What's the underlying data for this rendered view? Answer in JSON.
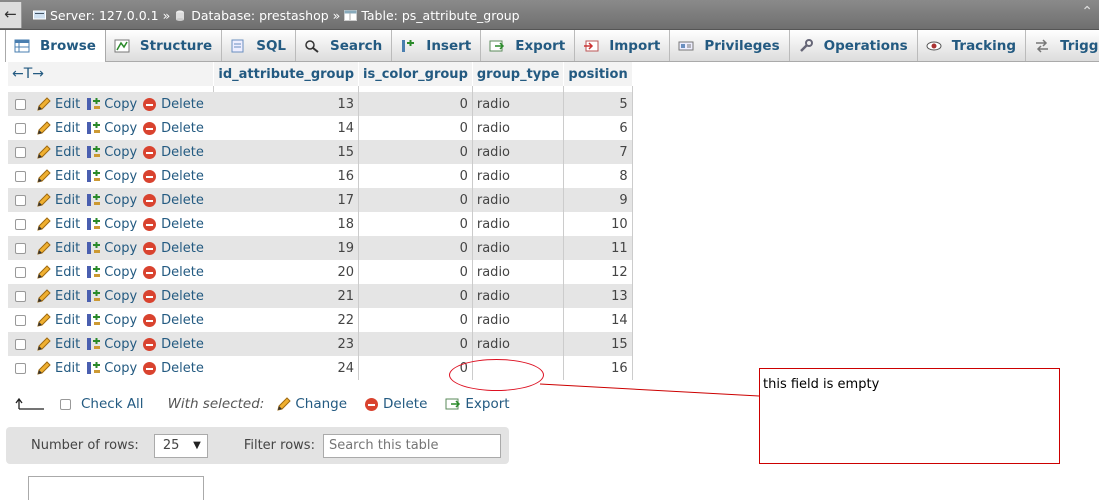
{
  "breadcrumb": {
    "server": "Server: 127.0.0.1",
    "database": "Database: prestashop",
    "table": "Table: ps_attribute_group",
    "separator": "»"
  },
  "tabs": [
    {
      "label": "Browse",
      "icon": "browse-icon"
    },
    {
      "label": "Structure",
      "icon": "structure-icon"
    },
    {
      "label": "SQL",
      "icon": "sql-icon"
    },
    {
      "label": "Search",
      "icon": "search-icon"
    },
    {
      "label": "Insert",
      "icon": "insert-icon"
    },
    {
      "label": "Export",
      "icon": "export-icon"
    },
    {
      "label": "Import",
      "icon": "import-icon"
    },
    {
      "label": "Privileges",
      "icon": "privileges-icon"
    },
    {
      "label": "Operations",
      "icon": "wrench-icon"
    },
    {
      "label": "Tracking",
      "icon": "eye-icon"
    },
    {
      "label": "Triggers",
      "icon": "triggers-icon"
    }
  ],
  "table": {
    "arrows": "←T→",
    "columns": [
      "id_attribute_group",
      "is_color_group",
      "group_type",
      "position"
    ],
    "row_actions": {
      "edit": "Edit",
      "copy": "Copy",
      "delete": "Delete"
    },
    "rows": [
      {
        "id": "13",
        "is_color": "0",
        "type": "radio",
        "pos": "5"
      },
      {
        "id": "14",
        "is_color": "0",
        "type": "radio",
        "pos": "6"
      },
      {
        "id": "15",
        "is_color": "0",
        "type": "radio",
        "pos": "7"
      },
      {
        "id": "16",
        "is_color": "0",
        "type": "radio",
        "pos": "8"
      },
      {
        "id": "17",
        "is_color": "0",
        "type": "radio",
        "pos": "9"
      },
      {
        "id": "18",
        "is_color": "0",
        "type": "radio",
        "pos": "10"
      },
      {
        "id": "19",
        "is_color": "0",
        "type": "radio",
        "pos": "11"
      },
      {
        "id": "20",
        "is_color": "0",
        "type": "radio",
        "pos": "12"
      },
      {
        "id": "21",
        "is_color": "0",
        "type": "radio",
        "pos": "13"
      },
      {
        "id": "22",
        "is_color": "0",
        "type": "radio",
        "pos": "14"
      },
      {
        "id": "23",
        "is_color": "0",
        "type": "radio",
        "pos": "15"
      },
      {
        "id": "24",
        "is_color": "0",
        "type": "",
        "pos": "16"
      }
    ]
  },
  "bulk": {
    "check_all": "Check All",
    "with_selected": "With selected:",
    "change": "Change",
    "delete": "Delete",
    "export": "Export"
  },
  "nav": {
    "rows_label": "Number of rows:",
    "rows_value": "25",
    "filter_label": "Filter rows:",
    "filter_placeholder": "Search this table"
  },
  "annotation": {
    "text": "this field is empty",
    "color": "#cc0000"
  },
  "colors": {
    "link": "#235a81",
    "row_alt": "#e5e5e5",
    "delete": "#d9432f"
  }
}
